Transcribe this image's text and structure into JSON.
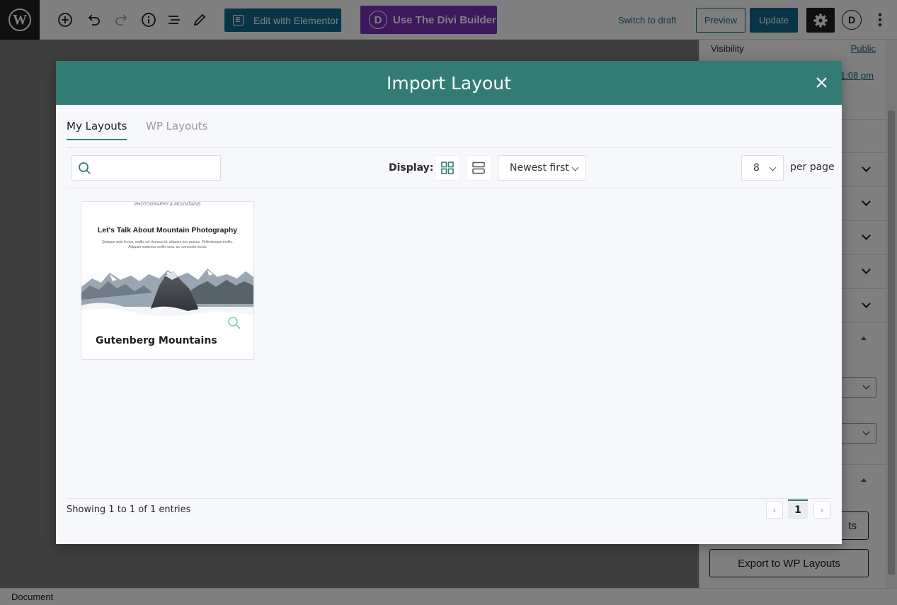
{
  "toolbar": {
    "edit_elementor_label": "Edit with Elementor",
    "divi_builder_label": "Use The Divi Builder",
    "switch_draft_label": "Switch to draft",
    "preview_label": "Preview",
    "update_label": "Update",
    "divi_circle_letter": "D",
    "icons": [
      "wordpress-logo",
      "add-block-icon",
      "undo-icon",
      "redo-icon",
      "info-icon",
      "list-view-icon",
      "edit-pencil-icon",
      "settings-gear-icon",
      "divi-circle-icon",
      "more-options-icon"
    ]
  },
  "sidebar": {
    "visibility_label": "Visibility",
    "visibility_value": "Public",
    "publish_time_fragment": "1:08 pm",
    "export_button_fragment": "ts",
    "export_wp_layouts_label": "Export to WP Layouts"
  },
  "footer": {
    "label": "Document"
  },
  "modal": {
    "title": "Import Layout",
    "tabs": [
      {
        "label": "My Layouts",
        "active": true
      },
      {
        "label": "WP Layouts",
        "active": false
      }
    ],
    "search": {
      "value": "",
      "placeholder": ""
    },
    "display_label": "Display:",
    "sort": {
      "selected": "Newest first"
    },
    "per_page": {
      "selected": "8",
      "label": "per page"
    },
    "layouts": [
      {
        "title": "Gutenberg Mountains",
        "thumbnail": {
          "kicker": "PHOTOGRAPHY & MOUNTAINS",
          "heading": "Let's Talk About Mountain Photography",
          "body": "Quisque ante lectus, mollis vel rhoncus id, aliquam nec massa. Pellentesque mollis. Aliquam maximus mollis uma, ac commodo lectus"
        }
      }
    ],
    "pagination": {
      "showing_text": "Showing 1 to 1 of 1 entries",
      "current_page": "1",
      "prev_symbol": "‹",
      "next_symbol": "›"
    }
  },
  "colors": {
    "modal_header": "#327c74",
    "elementor_button": "#0e6a8f",
    "divi_button": "#7b33b9",
    "wp_dark": "#1e1e1e"
  }
}
